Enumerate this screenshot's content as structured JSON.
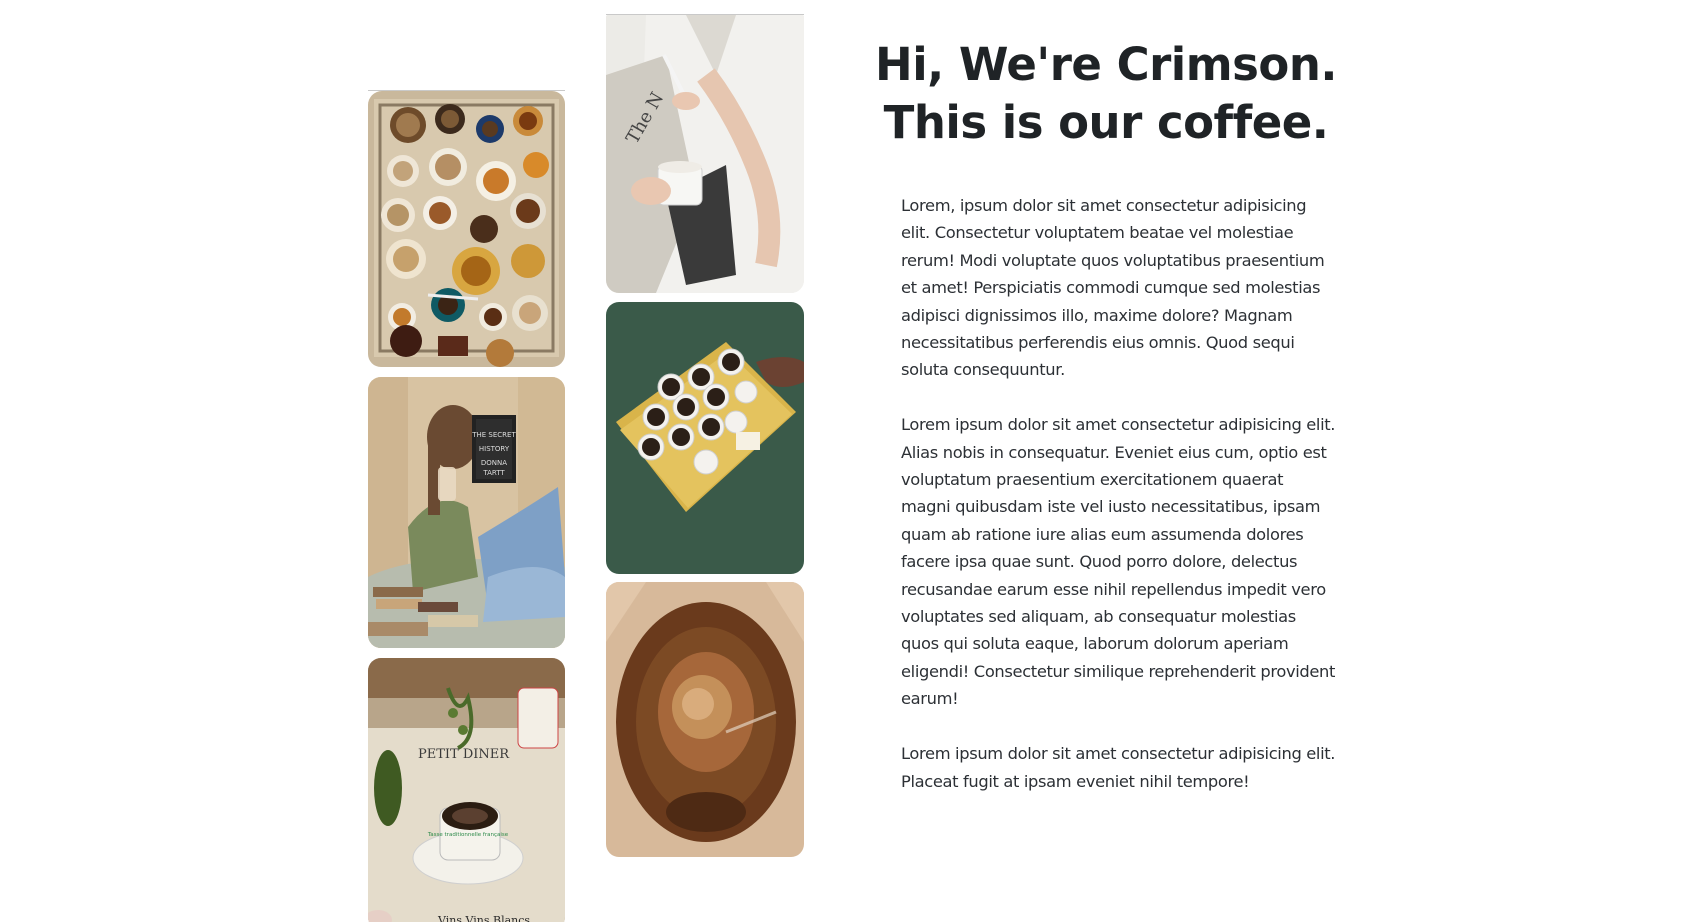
{
  "hero": {
    "headline_line1": "Hi, We're Crimson.",
    "headline_line2": "This is our coffee.",
    "paragraphs": [
      "Lorem, ipsum dolor sit amet consectetur adipisicing elit. Consectetur voluptatem beatae vel molestiae rerum! Modi voluptate quos voluptatibus praesentium et amet! Perspiciatis commodi cumque sed molestias adipisci dignissimos illo, maxime dolore? Magnam necessitatibus perferendis eius omnis. Quod sequi soluta consequuntur.",
      "Lorem ipsum dolor sit amet consectetur adipisicing elit. Alias nobis in consequatur. Eveniet eius cum, optio est voluptatum praesentium exercitationem quaerat magni quibusdam iste vel iusto necessitatibus, ipsam quam ab ratione iure alias eum assumenda dolores facere ipsa quae sunt. Quod porro dolore, delectus recusandae earum esse nihil repellendus impedit vero voluptates sed aliquam, ab consequatur molestias quos qui soluta eaque, laborum dolorum aperiam eligendi! Consectetur similique reprehenderit provident earum!",
      "Lorem ipsum dolor sit amet consectetur adipisicing elit. Placeat fugit at ipsam eveniet nihil tempore!"
    ]
  },
  "gallery": {
    "photo_labels": {
      "newspaper_heading": "The N",
      "book_title": "THE SECRET HISTORY DONNA TARTT",
      "menu_text": "PETIT DINER",
      "cup_text": "Tasse traditionnelle française",
      "bottom_text": "Vins Vins Blancs"
    }
  },
  "colors": {
    "text": "#212529",
    "background": "#ffffff",
    "tray_green": "#3a5a49",
    "tray_yellow": "#d9b44a"
  }
}
